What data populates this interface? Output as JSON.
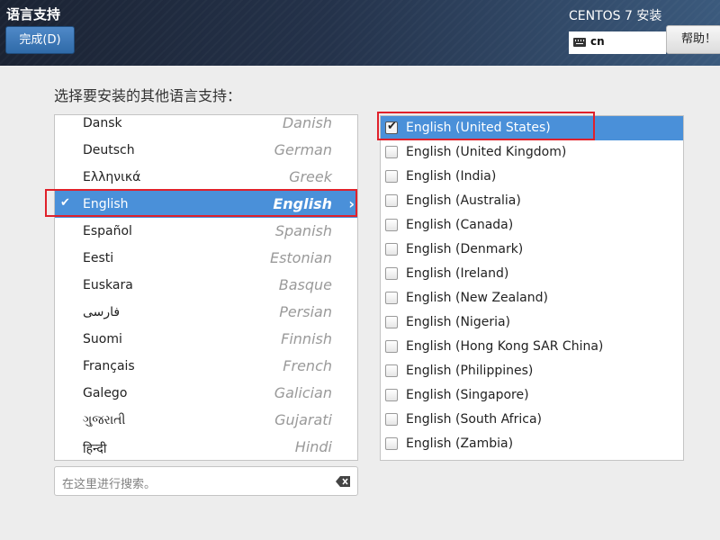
{
  "header": {
    "spoke_title": "语言支持",
    "done_label": "完成(D)",
    "product_title": "CENTOS 7 安装",
    "keyboard_layout": "cn",
    "help_label": "帮助！"
  },
  "prompt": "选择要安装的其他语言支持：",
  "languages": [
    {
      "native": "Dansk",
      "english": "Danish",
      "selected": false
    },
    {
      "native": "Deutsch",
      "english": "German",
      "selected": false
    },
    {
      "native": "Ελληνικά",
      "english": "Greek",
      "selected": false
    },
    {
      "native": "English",
      "english": "English",
      "selected": true
    },
    {
      "native": "Español",
      "english": "Spanish",
      "selected": false
    },
    {
      "native": "Eesti",
      "english": "Estonian",
      "selected": false
    },
    {
      "native": "Euskara",
      "english": "Basque",
      "selected": false
    },
    {
      "native": "فارسی",
      "english": "Persian",
      "selected": false
    },
    {
      "native": "Suomi",
      "english": "Finnish",
      "selected": false
    },
    {
      "native": "Français",
      "english": "French",
      "selected": false
    },
    {
      "native": "Galego",
      "english": "Galician",
      "selected": false
    },
    {
      "native": "ગુજરાતી",
      "english": "Gujarati",
      "selected": false
    },
    {
      "native": "हिन्दी",
      "english": "Hindi",
      "selected": false
    }
  ],
  "search": {
    "placeholder": "在这里进行搜索。"
  },
  "locales": [
    {
      "label": "English (United States)",
      "checked": true,
      "selected": true
    },
    {
      "label": "English (United Kingdom)",
      "checked": false,
      "selected": false
    },
    {
      "label": "English (India)",
      "checked": false,
      "selected": false
    },
    {
      "label": "English (Australia)",
      "checked": false,
      "selected": false
    },
    {
      "label": "English (Canada)",
      "checked": false,
      "selected": false
    },
    {
      "label": "English (Denmark)",
      "checked": false,
      "selected": false
    },
    {
      "label": "English (Ireland)",
      "checked": false,
      "selected": false
    },
    {
      "label": "English (New Zealand)",
      "checked": false,
      "selected": false
    },
    {
      "label": "English (Nigeria)",
      "checked": false,
      "selected": false
    },
    {
      "label": "English (Hong Kong SAR China)",
      "checked": false,
      "selected": false
    },
    {
      "label": "English (Philippines)",
      "checked": false,
      "selected": false
    },
    {
      "label": "English (Singapore)",
      "checked": false,
      "selected": false
    },
    {
      "label": "English (South Africa)",
      "checked": false,
      "selected": false
    },
    {
      "label": "English (Zambia)",
      "checked": false,
      "selected": false
    }
  ],
  "colors": {
    "selection": "#4a90d9",
    "highlight_box": "#e0212b",
    "done_button": "#3a76b6"
  }
}
